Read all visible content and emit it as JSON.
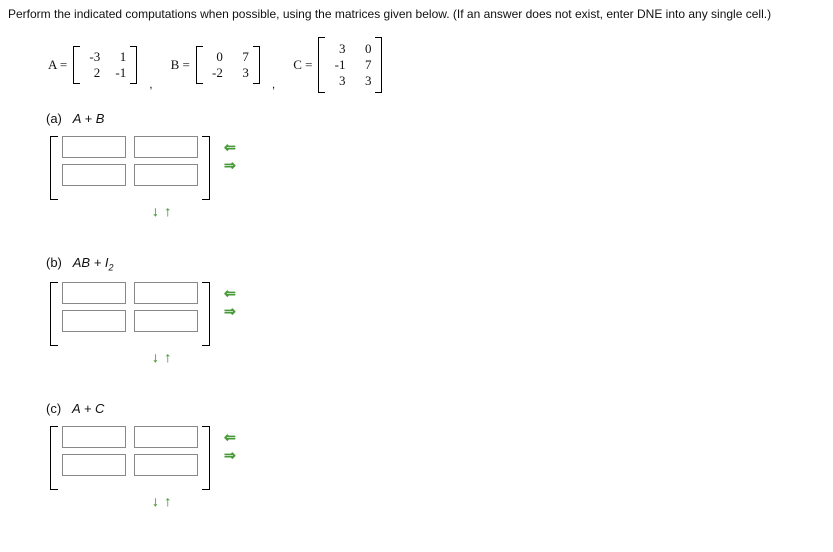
{
  "instructions": "Perform the indicated computations when possible, using the matrices given below. (If an answer does not exist, enter DNE into any single cell.)",
  "matrixA": {
    "label": "A =",
    "rows": [
      [
        "-3",
        "1"
      ],
      [
        "2",
        "-1"
      ]
    ]
  },
  "matrixB": {
    "label": "B =",
    "rows": [
      [
        "0",
        "7"
      ],
      [
        "-2",
        "3"
      ]
    ]
  },
  "matrixC": {
    "label": "C =",
    "rows": [
      [
        "3",
        "0"
      ],
      [
        "-1",
        "7"
      ],
      [
        "3",
        "3"
      ]
    ]
  },
  "parts": {
    "a": {
      "tag": "(a)",
      "expr_html": "A + B"
    },
    "b": {
      "tag": "(b)",
      "expr_html": "AB + I",
      "sub": "2"
    },
    "c": {
      "tag": "(c)",
      "expr_html": "A + C"
    }
  },
  "icons": {
    "col_remove": "⇐",
    "col_add": "⇒",
    "row_add": "↓",
    "row_remove": "↑"
  }
}
